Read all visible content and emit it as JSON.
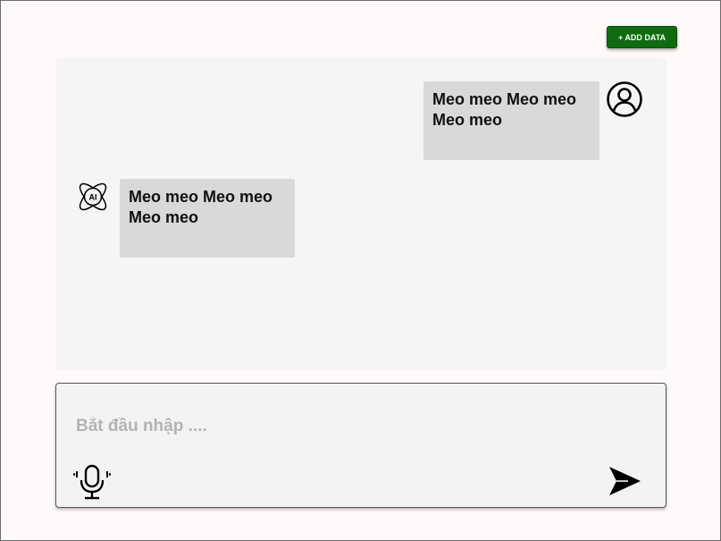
{
  "toolbar": {
    "add_data_label": "+ ADD DATA"
  },
  "chat": {
    "messages": [
      {
        "role": "user",
        "text": "Meo meo Meo meo Meo meo",
        "avatar_icon": "user-circle-icon"
      },
      {
        "role": "ai",
        "text": "Meo meo Meo meo Meo meo",
        "avatar_icon": "ai-atom-icon"
      }
    ]
  },
  "composer": {
    "placeholder": "Bắt đầu nhập ....",
    "value": "",
    "mic_icon": "microphone-icon",
    "send_icon": "send-icon"
  },
  "colors": {
    "accent": "#0f6b0f",
    "background": "#fff9f9",
    "chat_panel": "#f5f5f5",
    "bubble": "#d9d9d9"
  }
}
